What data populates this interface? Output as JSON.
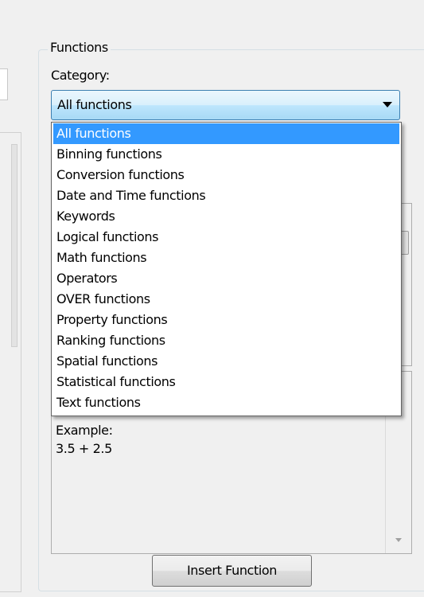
{
  "group": {
    "legend": "Functions"
  },
  "category": {
    "label": "Category:",
    "selected": "All functions",
    "options": [
      "All functions",
      "Binning functions",
      "Conversion functions",
      "Date and Time functions",
      "Keywords",
      "Logical functions",
      "Math functions",
      "Operators",
      "OVER functions",
      "Property functions",
      "Ranking functions",
      "Spatial functions",
      "Statistical functions",
      "Text functions"
    ]
  },
  "description": {
    "example_label": "Example:",
    "example_code": "3.5 + 2.5"
  },
  "buttons": {
    "insert": "Insert Function"
  },
  "colors": {
    "selection": "#3399ff",
    "combo_border": "#3c7fb1"
  }
}
